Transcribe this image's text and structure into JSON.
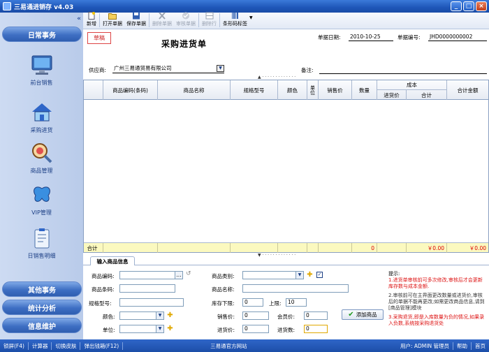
{
  "window": {
    "title": "三易通进销存 v4.03"
  },
  "sidebar": {
    "collapse_icon": "«",
    "header_top": "日常事务",
    "items": [
      {
        "label": "前台销售",
        "icon": "monitor-icon"
      },
      {
        "label": "采购进货",
        "icon": "house-icon"
      },
      {
        "label": "商品管理",
        "icon": "magnifier-icon"
      },
      {
        "label": "VIP管理",
        "icon": "butterfly-icon"
      },
      {
        "label": "日销售明细",
        "icon": "clipboard-icon"
      }
    ],
    "header_other": "其他事务",
    "header_stats": "统计分析",
    "header_info": "信息维护"
  },
  "toolbar": {
    "new": "新增",
    "open": "打开单据",
    "save": "保存单据",
    "delete": "删除单据",
    "audit": "审核单据",
    "delete_row": "删除行",
    "barcode": "条形码标签"
  },
  "form": {
    "draft": "草稿",
    "title": "采购进货单",
    "date_label": "单据日期:",
    "date_value": "2010-10-25",
    "no_label": "单据编号:",
    "no_value": "JHD0000000002",
    "supplier_label": "供应商:",
    "supplier_value": "广州三易通贸易有限公司",
    "remark_label": "备注:"
  },
  "grid": {
    "columns": [
      "商品编码(条码)",
      "商品名称",
      "规格型号",
      "颜色",
      "单位",
      "销售价",
      "数量"
    ],
    "cost_group": "成本",
    "cost_sub": [
      "进货价",
      "合计"
    ],
    "total_col": "合计金额",
    "total_row_label": "合计",
    "total_qty": "0",
    "total_cost": "￥0.00",
    "total_amount": "￥0.00"
  },
  "entry": {
    "tab": "输入商品信息",
    "code_label": "商品编码:",
    "browse": "...",
    "barcode_label": "商品条码:",
    "spec_label": "规格型号:",
    "color_label": "颜色:",
    "unit_label": "单位:",
    "category_label": "商品类别:",
    "name_label": "商品名称:",
    "min_stock_label": "库存下限:",
    "min_stock_value": "0",
    "max_stock_label": "上限:",
    "max_stock_value": "10",
    "sale_price_label": "销售价:",
    "sale_price_value": "0",
    "member_price_label": "会员价:",
    "member_price_value": "0",
    "cost_price_label": "进货价:",
    "cost_price_value": "0",
    "qty_label": "进货数:",
    "qty_value": "0",
    "add_button": "添加商品"
  },
  "hints": {
    "title": "提示:",
    "h1": "1.进货单审核前可多次修改,审核后才会更新库存数与成本金额.",
    "h2": "2.审核前可在主界面更改数量或进货价,审核后的单据不能再更改;如需更改商品信息,请到[商品管理]模块",
    "h3": "3.采购退货,即是入库数量为负的情况,如果录入负数,系统按采购退货处"
  },
  "status": {
    "lock": "锁屏(F4)",
    "calc": "计算器",
    "skin": "切换皮肤",
    "cash": "弹出钱箱(F12)",
    "site": "三易通官方网站",
    "user_label": "用户:",
    "user": "ADMIN 管理员",
    "help": "帮助",
    "home": "首页"
  },
  "colors": {
    "accent": "#2f5eb0",
    "total_row": "#fbf9bf",
    "hint_red": "#d11111"
  }
}
